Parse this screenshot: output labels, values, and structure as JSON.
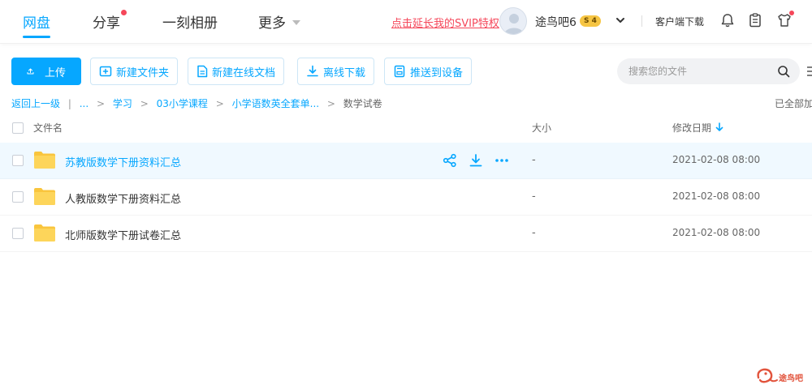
{
  "nav": {
    "tabs": [
      {
        "label": "网盘",
        "active": true
      },
      {
        "label": "分享",
        "has_dot": true
      },
      {
        "label": "一刻相册"
      },
      {
        "label": "更多"
      }
    ],
    "svip_link": "点击延长我的SVIP特权",
    "username": "途鸟吧6",
    "level_badge": "S 4",
    "client_download": "客户端下载",
    "icons": [
      "bell-icon",
      "clipboard-icon",
      "tshirt-icon"
    ],
    "accent_color": "#06a7ff",
    "alert_color": "#f5475a"
  },
  "toolbar": {
    "upload": "上传",
    "new_folder": "新建文件夹",
    "new_online_doc": "新建在线文档",
    "offline_download": "离线下载",
    "push_to_device": "推送到设备",
    "search_placeholder": "搜索您的文件"
  },
  "breadcrumb": {
    "back": "返回上一级",
    "ellipsis": "...",
    "items": [
      "学习",
      "03小学课程",
      "小学语数英全套单..."
    ],
    "current": "数学试卷",
    "loaded_status": "已全部加载"
  },
  "table": {
    "headers": {
      "name": "文件名",
      "size": "大小",
      "modified": "修改日期"
    },
    "sort": {
      "column": "modified",
      "direction": "desc"
    },
    "rows": [
      {
        "name": "苏教版数学下册资料汇总",
        "size": "-",
        "date": "2021-02-08 08:00",
        "hovered": true
      },
      {
        "name": "人教版数学下册资料汇总",
        "size": "-",
        "date": "2021-02-08 08:00"
      },
      {
        "name": "北师版数学下册试卷汇总",
        "size": "-",
        "date": "2021-02-08 08:00"
      }
    ],
    "row_action_icons": [
      "share-icon",
      "download-icon",
      "more-icon"
    ]
  },
  "watermark": {
    "text": "途鸟吧"
  }
}
